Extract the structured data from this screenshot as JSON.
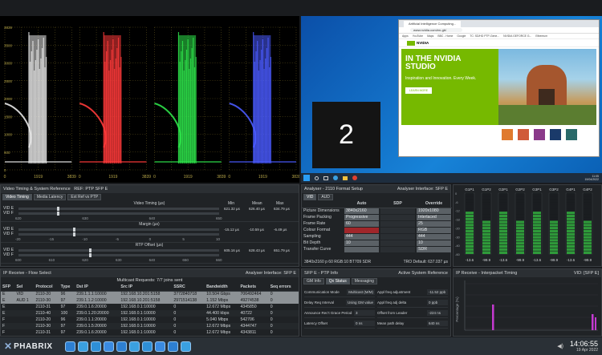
{
  "waveform": {
    "y_scale": [
      "3839",
      "3500",
      "3000",
      "2500",
      "2000",
      "1500",
      "1000",
      "500",
      "0"
    ],
    "x_scale": [
      "0",
      "1919",
      "3839"
    ],
    "panel_count": 4,
    "colors": [
      "#e8e8e8",
      "#ff3a3a",
      "#2ee34a",
      "#4a5bff"
    ]
  },
  "desktop": {
    "browser_title": "Artificial Intelligence Computing...",
    "address": "www.nvidia.com/en-gb/",
    "bookmarks": [
      "Apps",
      "YouTube",
      "Maps",
      "BBC - Home",
      "Google",
      "TC: SD/HD PTP-Gene...",
      "NVIDIA GEFORCE G...",
      "Ethereum"
    ],
    "brand": "NVIDIA",
    "headline": "IN THE NVIDIA STUDIO",
    "subtext": "Inspiration and Innovation. Every Week.",
    "learn_more": "LEARN MORE",
    "monitor_number": "2",
    "clock_time": "11:05",
    "clock_date": "19/04/2022",
    "swatch_colors": [
      "#e07a2e",
      "#d05a3a",
      "#8a3a8a",
      "#1a3a6a",
      "#2a6a6a"
    ]
  },
  "video_timing": {
    "title": "Video Timing & System Reference",
    "ref": "REF: PTP SFP E",
    "tabs": [
      "Video Timing",
      "Media Latency",
      "Ext Ref vs PTP"
    ],
    "headers": [
      "Min",
      "Mean",
      "Max"
    ],
    "groups": [
      {
        "label": "Video Timing (µs)",
        "rows": [
          "VID E",
          "VID F"
        ],
        "min": "621.32 µs",
        "mean": "626.40 µs",
        "max": "634.79 µs",
        "ticks": [
          "620",
          "630",
          "640",
          "650"
        ]
      },
      {
        "label": "Margin (µs)",
        "rows": [
          "VID E",
          "VID F"
        ],
        "min": "-15.12 µs",
        "mean": "-10.59 µs",
        "max": "-6.49 µs",
        "ticks": [
          "-20",
          "-15",
          "-10",
          "-5",
          "0",
          "5",
          "10"
        ]
      },
      {
        "label": "RTP Offset (µs)",
        "rows": [
          "VID E",
          "VID F"
        ],
        "min": "605.16 µs",
        "mean": "628.43 µs",
        "max": "651.79 µs",
        "ticks": [
          "600",
          "610",
          "620",
          "630",
          "640",
          "650",
          "660"
        ]
      }
    ]
  },
  "flow_select": {
    "title": "IP Receive - Flow Select",
    "interface": "Analyser Interface: SFP E",
    "multicast": "Multicast Requests: 7/7 joins sent",
    "headers": [
      "SFP",
      "Sel",
      "Protocol",
      "Type",
      "Dst IP",
      "Src IP",
      "SSRC",
      "Bandwidth",
      "Packets",
      "Seq errors"
    ],
    "rows": [
      [
        "E",
        "VID",
        "2110-20",
        "96",
        "239.1.1.1:10000",
        "192.168.10.201:5158",
        "3772840718",
        "10.504 Gbps",
        "706492464",
        "0"
      ],
      [
        "E",
        "AUD 1",
        "2110-30",
        "97",
        "239.1.1.2:10000",
        "192.168.10.201:5158",
        "2971514138",
        "1.152 Mbps",
        "49274538",
        "0"
      ],
      [
        "E",
        "",
        "2110-31",
        "97",
        "239.0.1.6:20000",
        "192.168.0.1:10000",
        "0",
        "12.672 Mbps",
        "4345850",
        "0"
      ],
      [
        "E",
        "",
        "2110-40",
        "100",
        "239.0.1.20:20000",
        "192.168.0.1:10000",
        "0",
        "44.400 kbps",
        "40722",
        "0"
      ],
      [
        "F",
        "",
        "2110-20",
        "96",
        "239.0.1.1:20000",
        "192.168.0.1:10000",
        "0",
        "5.040 Mbps",
        "542706",
        "0"
      ],
      [
        "F",
        "",
        "2110-30",
        "97",
        "239.0.1.5:20000",
        "192.168.0.1:10000",
        "0",
        "12.672 Mbps",
        "4344747",
        "0"
      ],
      [
        "F",
        "",
        "2110-31",
        "97",
        "239.0.1.6:20000",
        "192.168.0.1:10000",
        "0",
        "12.672 Mbps",
        "4343811",
        "0"
      ]
    ]
  },
  "format_setup": {
    "title": "Analyser - 2110 Format Setup",
    "interface": "Analyser Interface: SFP E",
    "tabs": [
      "VID",
      "AUD"
    ],
    "col_headers": [
      "Auto",
      "SDP",
      "Override"
    ],
    "rows": [
      {
        "label": "Picture Dimensions",
        "auto": "3840x2160",
        "sdp": "",
        "override": "1920x1080"
      },
      {
        "label": "Frame Packing",
        "auto": "Progressive",
        "sdp": "",
        "override": "Interlaced"
      },
      {
        "label": "Frame Rate",
        "auto": "60",
        "sdp": "",
        "override": "25"
      },
      {
        "label": "Colour Format",
        "auto": "",
        "sdp": "",
        "override": "RGB"
      },
      {
        "label": "Sampling",
        "auto": "444",
        "sdp": "",
        "override": "444"
      },
      {
        "label": "Bit Depth",
        "auto": "10",
        "sdp": "",
        "override": "10"
      },
      {
        "label": "Transfer Curve",
        "auto": "",
        "sdp": "",
        "override": "SDR"
      }
    ],
    "footer_left": "3840x2160 p 60 RGB:10 BT709 SDR",
    "footer_right": "TRO Default: 637.037 µs"
  },
  "audio_meters": {
    "labels": [
      "G1P1",
      "G1P2",
      "G2P1",
      "G2P2",
      "G3P1",
      "G3P2",
      "G4P1",
      "G4P2"
    ],
    "values": [
      "-13.6",
      "-99.9",
      "-13.6",
      "-99.9",
      "-13.6",
      "-99.9",
      "-13.6",
      "-99.9"
    ],
    "scale": [
      "0",
      "-6",
      "-12",
      "-18",
      "-20",
      "-30",
      "-40",
      "-60"
    ]
  },
  "ptp_info": {
    "title": "SFP E - PTP Info",
    "interface": "Active System Reference",
    "tabs": [
      "GM Info",
      "Qx Status",
      "Messaging"
    ],
    "left": [
      {
        "label": "Communication Mode",
        "value": "Multicast (M/M)"
      },
      {
        "label": "Delay Req Interval",
        "value": "Using GM value"
      },
      {
        "label": "Announce Rec't Grace Period",
        "value": "3"
      },
      {
        "label": "Latency Offset",
        "value": "0 ns"
      }
    ],
    "right": [
      {
        "label": "Appl freq adjustment",
        "value": "-11.52 ppb"
      },
      {
        "label": "Appl freq adj delta",
        "value": "0 ppb"
      },
      {
        "label": "Offset from Leader",
        "value": "-224 ns"
      },
      {
        "label": "Mean path delay",
        "value": "640 ns"
      }
    ]
  },
  "interpacket": {
    "title": "IP Receive - Interpacket Timing",
    "vid": "VID: [SFP E]",
    "ylabel": "Percentage (%)",
    "bar_color": "#c43ad0"
  },
  "taskbar": {
    "brand": "PHABRIX",
    "icons": [
      "#2d7fd2",
      "#3aa0e0",
      "#2e8fd6",
      "#3a8ae0",
      "#2d7fd2",
      "#3aa0e0",
      "#2e8fd6",
      "#3a8ae0",
      "#2d7fd2",
      "#3aa0e0"
    ],
    "time": "14:06:55",
    "date": "19 Apr 2022"
  }
}
